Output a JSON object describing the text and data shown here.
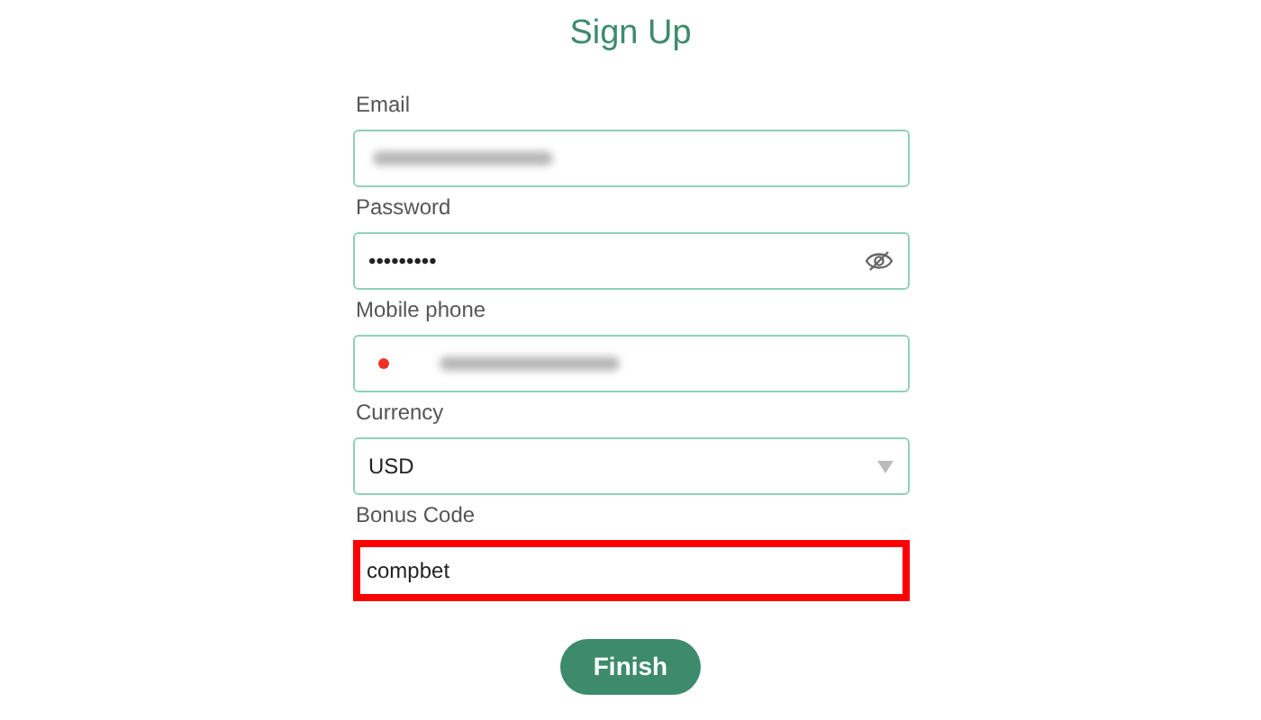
{
  "title": "Sign Up",
  "fields": [
    {
      "label": "Email",
      "kind": "blurred",
      "highlighted": false
    },
    {
      "label": "Password",
      "kind": "password",
      "value": "•••••••••",
      "highlighted": false
    },
    {
      "label": "Mobile phone",
      "kind": "phone",
      "highlighted": false
    },
    {
      "label": "Currency",
      "kind": "select",
      "value": "USD",
      "highlighted": false
    },
    {
      "label": "Bonus Code",
      "kind": "text",
      "value": "compbet",
      "highlighted": true
    }
  ],
  "button": "Finish"
}
